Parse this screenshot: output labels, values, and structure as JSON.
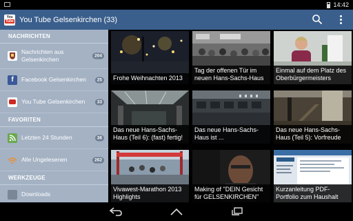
{
  "status_bar": {
    "time": "14:42"
  },
  "app": {
    "title": "You Tube Gelsenkirchen (33)",
    "logo_top": "You",
    "logo_bottom": "Tube"
  },
  "sidebar": {
    "sections": [
      {
        "header": "NACHRICHTEN",
        "items": [
          {
            "label": "Nachrichten aus Gelsenkirchen",
            "count": "204",
            "icon": "city-crest-icon",
            "color": "#8a3b2e"
          },
          {
            "label": "Facebook Gelsenkirchen",
            "count": "25",
            "icon": "facebook-icon",
            "color": "#3b5998"
          },
          {
            "label": "You Tube Gelsenkirchen",
            "count": "33",
            "icon": "youtube-icon",
            "color": "#cc2a22"
          }
        ]
      },
      {
        "header": "FAVORITEN",
        "items": [
          {
            "label": "Letzten 24 Stunden",
            "count": "36",
            "icon": "rss-icon",
            "color": "#6aa84f"
          },
          {
            "label": "Alle Ungelesenen",
            "count": "262",
            "icon": "feed-icon",
            "color": "#e69138"
          }
        ]
      },
      {
        "header": "WERKZEUGE",
        "items": [
          {
            "label": "Downloads",
            "count": "",
            "icon": "download-icon",
            "color": "#7a8797"
          }
        ]
      }
    ]
  },
  "videos": [
    {
      "title": "Frohe Weihnachten 2013",
      "scene": "night-lights"
    },
    {
      "title": "Tag der offenen Tür im neuen Hans-Sachs-Haus",
      "scene": "crowd-hall"
    },
    {
      "title": "Einmal auf dem Platz des Oberbürgermeisters",
      "scene": "office-woman"
    },
    {
      "title": "Das neue Hans-Sachs-Haus (Teil 6): (fast) fertig!",
      "scene": "atrium"
    },
    {
      "title": "Das neue Hans-Sachs-Haus ist ...",
      "scene": "building-facade"
    },
    {
      "title": "Das neue Hans-Sachs-Haus (Teil 5): Vorfreude",
      "scene": "interior-stairs"
    },
    {
      "title": "Vivawest-Marathon 2013 Highlights",
      "scene": "marathon"
    },
    {
      "title": "Making of \"DEIN Gesicht für GELSENKIRCHEN\"",
      "scene": "portrait-man"
    },
    {
      "title": "Kurzanleitung PDF-Portfolio zum Haushalt",
      "scene": "document-screen"
    }
  ]
}
